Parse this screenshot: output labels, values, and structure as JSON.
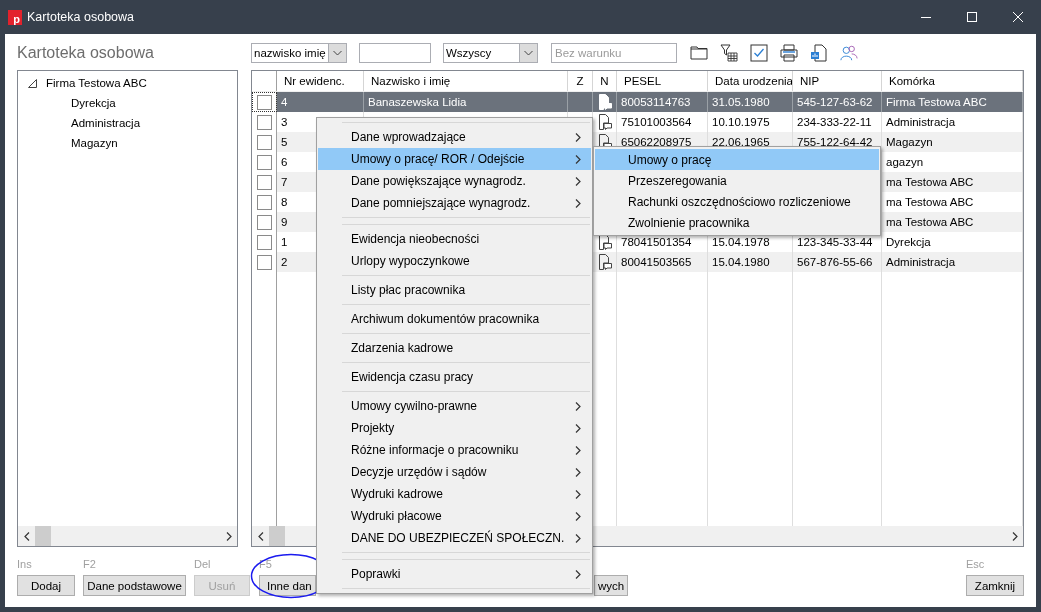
{
  "window": {
    "title": "Kartoteka osobowa",
    "icon_text": "p"
  },
  "heading": "Kartoteka osobowa",
  "filters": [
    {
      "kind": "select",
      "value": "nazwisko imię"
    },
    {
      "kind": "input"
    },
    {
      "kind": "select",
      "value": "Wszyscy"
    },
    {
      "kind": "input",
      "placeholder": "Bez warunku"
    }
  ],
  "tree": {
    "label": "Firma Testowa ABC",
    "expanded": true,
    "children": [
      {
        "label": "Dyrekcja"
      },
      {
        "label": "Administracja"
      },
      {
        "label": "Magazyn"
      }
    ]
  },
  "table": {
    "columns": [
      "Nr ewidenc.",
      "Nazwisko i imię",
      "Z",
      "N",
      "PESEL",
      "Data urodzenia",
      "NIP",
      "Komórka"
    ],
    "rows": [
      {
        "selected": true,
        "checked": false,
        "document_icon": true,
        "nr": "4",
        "name": "Banaszewska Lidia",
        "pesel": "80053114763",
        "birth_date": "31.05.1980",
        "nip": "545-127-63-62",
        "unit": "Firma Testowa ABC"
      },
      {
        "selected": false,
        "checked": false,
        "document_icon": true,
        "nr": "3",
        "pesel": "75101003564",
        "birth_date": "10.10.1975",
        "nip": "234-333-22-11",
        "unit": "Administracja"
      },
      {
        "selected": false,
        "checked": false,
        "document_icon": true,
        "nr": "5",
        "pesel": "65062208975",
        "birth_date": "22.06.1965",
        "nip": "755-122-64-42",
        "unit": "Magazyn"
      },
      {
        "selected": false,
        "checked": false,
        "document_icon": false,
        "nr": "6",
        "unit": "agazyn"
      },
      {
        "selected": false,
        "checked": false,
        "document_icon": false,
        "nr": "7",
        "unit": "ma Testowa ABC"
      },
      {
        "selected": false,
        "checked": false,
        "document_icon": false,
        "nr": "8",
        "unit": "ma Testowa ABC"
      },
      {
        "selected": false,
        "checked": false,
        "document_icon": false,
        "nr": "9",
        "unit": "ma Testowa ABC"
      },
      {
        "selected": false,
        "checked": false,
        "document_icon": true,
        "nr": "1",
        "pesel": "78041501354",
        "birth_date": "15.04.1978",
        "nip": "123-345-33-44",
        "unit": "Dyrekcja"
      },
      {
        "selected": false,
        "checked": false,
        "document_icon": true,
        "nr": "2",
        "pesel": "80041503565",
        "birth_date": "15.04.1980",
        "nip": "567-876-55-66",
        "unit": "Administracja"
      }
    ]
  },
  "buttons": [
    {
      "shortcut": "Ins",
      "label": "Dodaj",
      "disabled": false
    },
    {
      "shortcut": "F2",
      "label": "Dane podstawowe",
      "disabled": false
    },
    {
      "shortcut": "Del",
      "label": "Usuń",
      "disabled": true
    },
    {
      "shortcut": "F5",
      "label": "Inne dan",
      "disabled": false
    },
    {
      "label": "wych",
      "disabled": false
    }
  ],
  "close_button": {
    "shortcut": "Esc",
    "label": "Zamknij"
  },
  "context_menu": {
    "items": [
      {
        "kind": "separator"
      },
      {
        "kind": "item",
        "label": "Dane wprowadzające",
        "submenu": true,
        "selected": false
      },
      {
        "kind": "item",
        "label": "Umowy o pracę/ ROR / Odejście",
        "submenu": true,
        "selected": true
      },
      {
        "kind": "item",
        "label": "Dane powiększające wynagrodz.",
        "submenu": true,
        "selected": false
      },
      {
        "kind": "item",
        "label": "Dane pomniejszające wynagrodz.",
        "submenu": true,
        "selected": false
      },
      {
        "kind": "separator"
      },
      {
        "kind": "separator"
      },
      {
        "kind": "item",
        "label": "Ewidencja nieobecności",
        "submenu": false,
        "selected": false
      },
      {
        "kind": "item",
        "label": "Urlopy wypoczynkowe",
        "submenu": false,
        "selected": false
      },
      {
        "kind": "separator"
      },
      {
        "kind": "item",
        "label": "Listy płac pracownika",
        "submenu": false,
        "selected": false
      },
      {
        "kind": "separator"
      },
      {
        "kind": "item",
        "label": "Archiwum dokumentów pracownika",
        "submenu": false,
        "selected": false
      },
      {
        "kind": "separator"
      },
      {
        "kind": "item",
        "label": "Zdarzenia kadrowe",
        "submenu": false,
        "selected": false
      },
      {
        "kind": "separator"
      },
      {
        "kind": "item",
        "label": "Ewidencja czasu pracy",
        "submenu": false,
        "selected": false
      },
      {
        "kind": "separator"
      },
      {
        "kind": "item",
        "label": "Umowy cywilno-prawne",
        "submenu": true,
        "selected": false
      },
      {
        "kind": "item",
        "label": "Projekty",
        "submenu": true,
        "selected": false
      },
      {
        "kind": "item",
        "label": "Różne informacje o pracowniku",
        "submenu": true,
        "selected": false
      },
      {
        "kind": "item",
        "label": "Decyzje urzędów i sądów",
        "submenu": true,
        "selected": false
      },
      {
        "kind": "item",
        "label": "Wydruki kadrowe",
        "submenu": true,
        "selected": false
      },
      {
        "kind": "item",
        "label": "Wydruki płacowe",
        "submenu": true,
        "selected": false
      },
      {
        "kind": "item",
        "label": "DANE DO UBEZPIECZEŃ SPOŁECZN.",
        "submenu": true,
        "selected": false
      },
      {
        "kind": "separator"
      },
      {
        "kind": "separator"
      },
      {
        "kind": "item",
        "label": "Poprawki",
        "submenu": true,
        "selected": false
      },
      {
        "kind": "separator"
      }
    ]
  },
  "submenu": {
    "items": [
      {
        "label": "Umowy o pracę",
        "selected": true
      },
      {
        "label": "Przeszeregowania",
        "selected": false
      },
      {
        "label": "Rachunki oszczędnościowo rozliczeniowe",
        "selected": false
      },
      {
        "label": "Zwolnienie pracownika",
        "selected": false
      }
    ]
  }
}
